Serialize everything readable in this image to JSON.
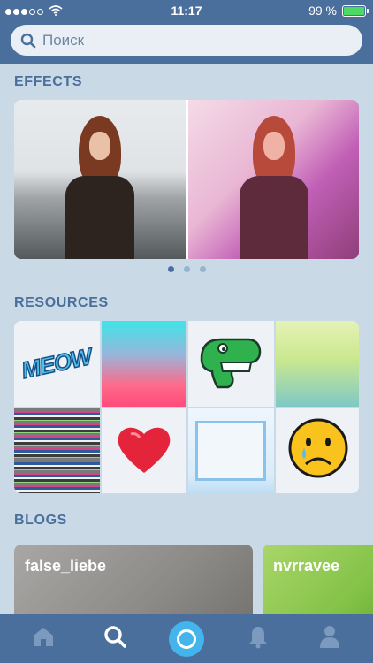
{
  "status_bar": {
    "time": "11:17",
    "battery": "99 %",
    "signal_icon": "signal-dots-icon",
    "wifi_icon": "wifi-icon"
  },
  "search": {
    "placeholder": "Поиск",
    "icon": "search-icon"
  },
  "sections": {
    "effects": "EFFECTS",
    "resources": "RESOURCES",
    "blogs": "BLOGS"
  },
  "effects_pager": {
    "pages": 3,
    "active": 1
  },
  "resources": [
    {
      "type": "sticker",
      "text": "MEOW"
    },
    {
      "type": "gradient"
    },
    {
      "type": "sticker",
      "icon": "dinosaur-icon"
    },
    {
      "type": "sky"
    },
    {
      "type": "glitch"
    },
    {
      "type": "sticker",
      "icon": "heart-icon"
    },
    {
      "type": "frame"
    },
    {
      "type": "sticker",
      "icon": "crying-face-icon"
    }
  ],
  "blogs": [
    {
      "name": "false_liebe"
    },
    {
      "name": "nvrravee"
    }
  ],
  "tabbar": {
    "items": [
      "home-icon",
      "search-icon",
      "camera-icon",
      "bell-icon",
      "profile-icon"
    ],
    "active": "search-icon",
    "accent": "#43b5ec"
  },
  "colors": {
    "primary": "#4a6f9c",
    "background": "#c9d9e6"
  }
}
